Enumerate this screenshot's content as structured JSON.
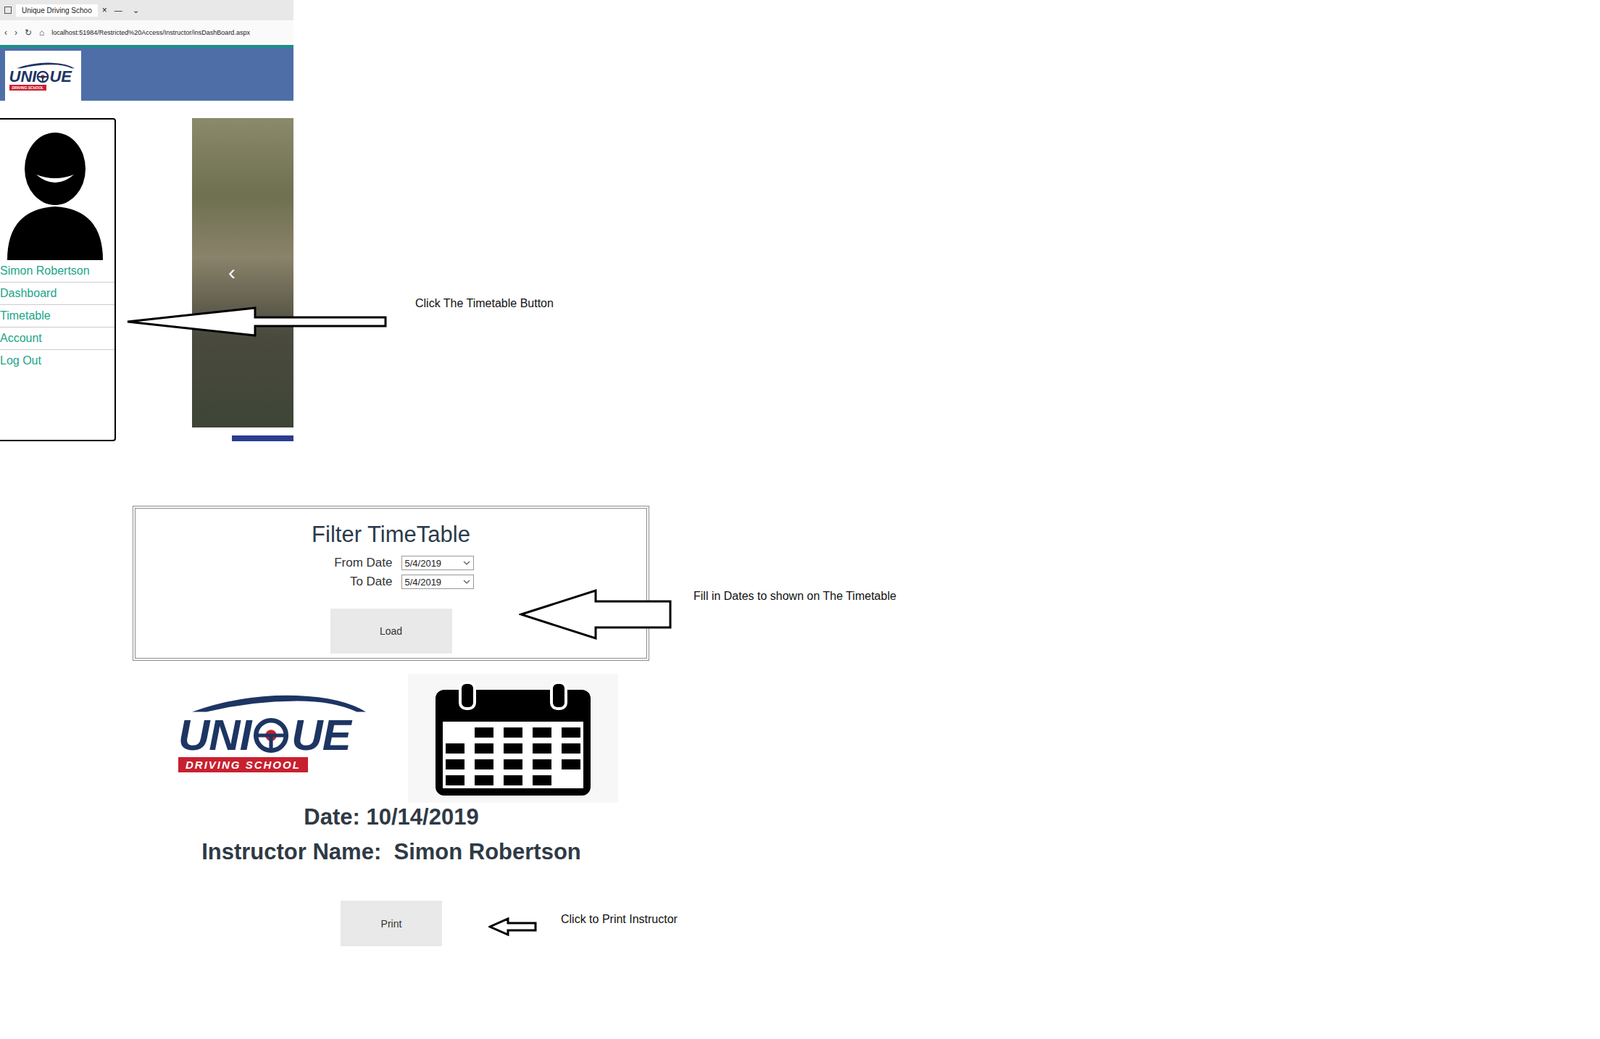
{
  "browser": {
    "tab_title": "Unique Driving Schoo",
    "tab_close": "×",
    "window_controls": [
      "—",
      "⌄"
    ],
    "nav": [
      "‹",
      "›",
      "↻",
      "⌂"
    ],
    "address": "localhost:51984/Restricted%20Access/Instructor/insDashBoard.aspx"
  },
  "logo": {
    "left": "UNI",
    "right": "UE",
    "tagline": "DRIVING SCHOOL"
  },
  "sidebar": {
    "user": "Simon Robertson",
    "items": [
      {
        "label": "Dashboard",
        "selected": false
      },
      {
        "label": "Timetable",
        "selected": false
      },
      {
        "label": "Account",
        "selected": false
      },
      {
        "label": "Log Out",
        "selected": false
      }
    ]
  },
  "carousel": {
    "prev": "‹"
  },
  "annotations": {
    "timetable": "Click The Timetable Button",
    "dates": "Fill in Dates to shown on The Timetable",
    "print": "Click to Print Instructor"
  },
  "filter": {
    "title": "Filter TimeTable",
    "from_label": "From Date",
    "from_value": "5/4/2019",
    "to_label": "To Date",
    "to_value": "5/4/2019",
    "load": "Load"
  },
  "report": {
    "date": "Date: 10/14/2019",
    "instructor_label": "Instructor Name:",
    "instructor": "Simon Robertson",
    "print": "Print"
  }
}
